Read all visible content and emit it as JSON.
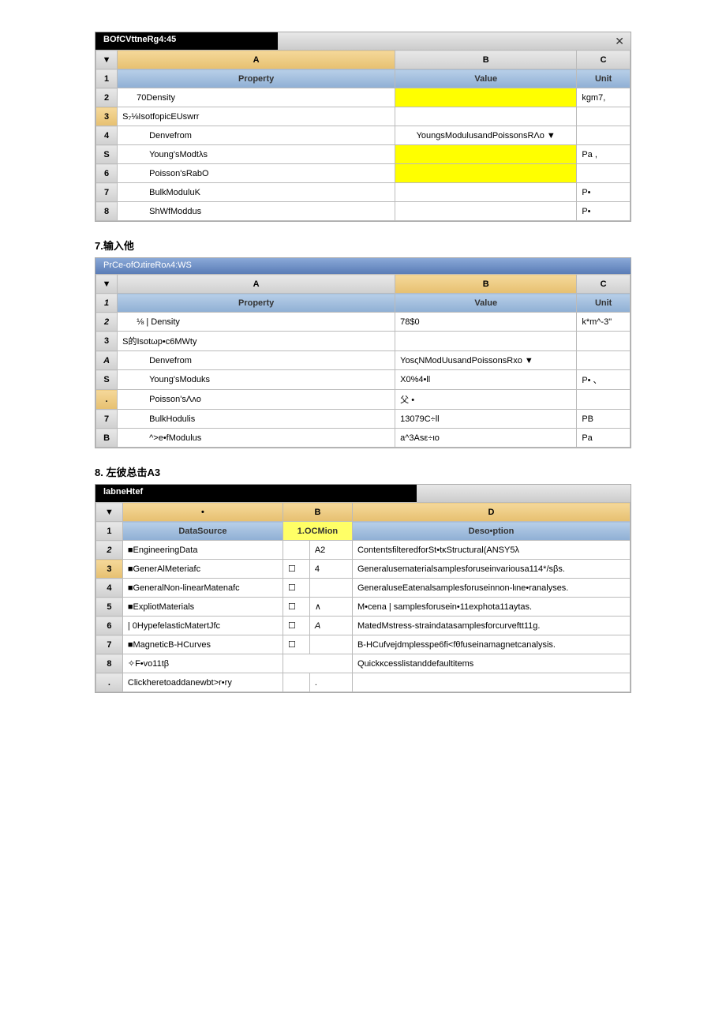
{
  "table1": {
    "title": "BOfCVttneRg4:45",
    "close": "✕",
    "cols": {
      "a": "A",
      "b": "B",
      "c": "C"
    },
    "dropdown": "▼",
    "subhdr": {
      "prop": "Property",
      "val": "Value",
      "unit": "Unit"
    },
    "rows": [
      {
        "n": "1",
        "num_tan": false
      },
      {
        "n": "2",
        "a": "70Density",
        "b": "",
        "c": "kgm7,",
        "byellow": true
      },
      {
        "n": "3",
        "a": "S₇⅛IsotfopicEUswrr",
        "b": "",
        "c": "",
        "num_tan": true,
        "noindent": true
      },
      {
        "n": "4",
        "a": "Denvefrom",
        "b": "YoungsModulusandPoissonsRΛo ▼",
        "c": ""
      },
      {
        "n": "S",
        "a": "Young'sModtλs",
        "b": "",
        "c": "Pa   ,",
        "byellow": true
      },
      {
        "n": "6",
        "a": "Poisson'sRabO",
        "b": "",
        "c": "",
        "byellow": true
      },
      {
        "n": "7",
        "a": "BulkModuluK",
        "b": "",
        "c": "P•"
      },
      {
        "n": "8",
        "a": "ShWfModdus",
        "b": "",
        "c": "P•"
      }
    ]
  },
  "step7": "7.输入他",
  "table2": {
    "title": "PrCe-ofOɹtireRoᴧ4:WS",
    "cols": {
      "a": "A",
      "b": "B",
      "c": "C"
    },
    "dropdown": "▼",
    "subhdr": {
      "prop": "Property",
      "val": "Value",
      "unit": "Unit"
    },
    "rows": [
      {
        "n": "1",
        "italic": true
      },
      {
        "n": "2",
        "a": "⅛ | Density",
        "b": "78$0",
        "c": "k*m^-3\"",
        "italic": true
      },
      {
        "n": "3",
        "a": "S的Isotωp•c6MWty",
        "noindent": true
      },
      {
        "n": "A",
        "a": "Denvefrom",
        "b": "YosςNModUusandPoissonsRxo ▼",
        "c": "",
        "italic": true
      },
      {
        "n": "S",
        "a": "Young'sModuks",
        "b": "X0%4•ll",
        "c": "P• 、"
      },
      {
        "n": ".",
        "a": "Poisson'sΛᴧo",
        "b": "父 •",
        "c": "",
        "num_tan": true
      },
      {
        "n": "7",
        "a": "BulkHodulis",
        "b": "13079C÷ll",
        "c": "PB"
      },
      {
        "n": "B",
        "a": "^>e•fModulus",
        "b": "a^3Asε÷ιo",
        "c": "Pa"
      }
    ]
  },
  "step8": "8. 左彼总击A3",
  "table3": {
    "title": "labneHtef",
    "cols": {
      "a": "•",
      "b": "B",
      "d": "D"
    },
    "dropdown": "▼",
    "subhdr": {
      "src": "DataSource",
      "loc": "1.OCMion",
      "desc": "Deso•ption"
    },
    "rows": [
      {
        "n": "1"
      },
      {
        "n": "2",
        "a": "■EngineeringData",
        "b2": "A2",
        "d": "ContentsfilteredforSt•tᴋStructural(ANSY5λ",
        "italic": true
      },
      {
        "n": "3",
        "a": "■GenerAlMeteriafc",
        "b2": "4",
        "d": "Generalusematerialsamplesforuseinvariousa114*/sβs.",
        "num_tan": true
      },
      {
        "n": "4",
        "a": "■GeneralNon-linearMatenafc",
        "b2": "",
        "d": "GeneraluseEatenalsamplesforuseinnon-lιne•ranalyses."
      },
      {
        "n": "5",
        "a": "■ExpliotMaterials",
        "b2": "∧",
        "d": "M•cena | samplesforusein•11exphota11aytas."
      },
      {
        "n": "6",
        "a": "| 0HypefelasticMatertJfc",
        "b2": "A",
        "d": "MatedMstress-straindatasamplesforcurveftt11g.",
        "b2i": true
      },
      {
        "n": "7",
        "a": "■MagneticB-HCurves",
        "b2": "",
        "d": "B-HCufvejdmplesspe6fi<fθfuseinamagnetcanalysis."
      },
      {
        "n": "8",
        "a": "✧F•vo11tβ",
        "d": "Quickᴋcesslistanddefaultitems"
      },
      {
        "n": ".",
        "a": "Clickheretoaddanewbt>r•ry",
        "b2": ".",
        "d": ""
      }
    ]
  }
}
